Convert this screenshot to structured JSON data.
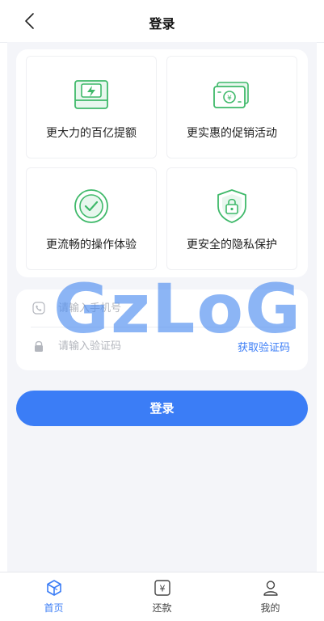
{
  "header": {
    "title": "登录"
  },
  "features": [
    {
      "label": "更大力的百亿提额",
      "icon": "money-case-icon"
    },
    {
      "label": "更实惠的促销活动",
      "icon": "banknote-icon"
    },
    {
      "label": "更流畅的操作体验",
      "icon": "check-badge-icon"
    },
    {
      "label": "更安全的隐私保护",
      "icon": "lock-shield-icon"
    }
  ],
  "form": {
    "phone_placeholder": "请输入手机号",
    "code_placeholder": "请输入验证码",
    "get_code_label": "获取验证码"
  },
  "watermark": "GzLoG",
  "login_button": "登录",
  "tabs": [
    {
      "label": "首页",
      "icon": "home-cube-icon",
      "active": true
    },
    {
      "label": "还款",
      "icon": "yen-bill-icon",
      "active": false
    },
    {
      "label": "我的",
      "icon": "user-icon",
      "active": false
    }
  ],
  "colors": {
    "accent": "#3b7df6",
    "feature_icon_green": "#3fb96a",
    "page_background": "#f4f5f9",
    "watermark": "#4f8ef1"
  }
}
